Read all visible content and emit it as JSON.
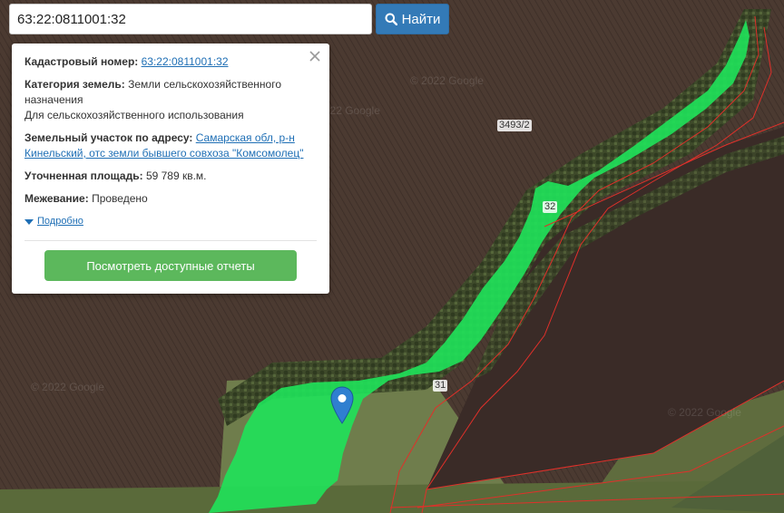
{
  "search": {
    "value": "63:22:0811001:32",
    "button_label": "Найти",
    "button_icon": "search-icon"
  },
  "popup": {
    "cadastral_label": "Кадастровый номер:",
    "cadastral_value": "63:22:0811001:32",
    "category_label": "Категория земель:",
    "category_value": "Земли сельскохозяйственного назначения",
    "category_use": "Для сельскохозяйственного использования",
    "address_label": "Земельный участок по адресу:",
    "address_value": "Самарская обл, р-н Кинельский, отс земли бывшего совхоза \"Комсомолец\"",
    "area_label": "Уточненная площадь:",
    "area_value": "59 789 кв.м.",
    "survey_label": "Межевание:",
    "survey_value": "Проведено",
    "more_link": "Подробно",
    "reports_button": "Посмотреть доступные отчеты"
  },
  "map": {
    "parcel_labels": [
      "3493/2",
      "32",
      "31"
    ],
    "watermark": "© 2022 Google",
    "highlight_color": "#1fe35a",
    "boundary_color": "#e0302a",
    "marker_color": "#2f7fd0"
  }
}
